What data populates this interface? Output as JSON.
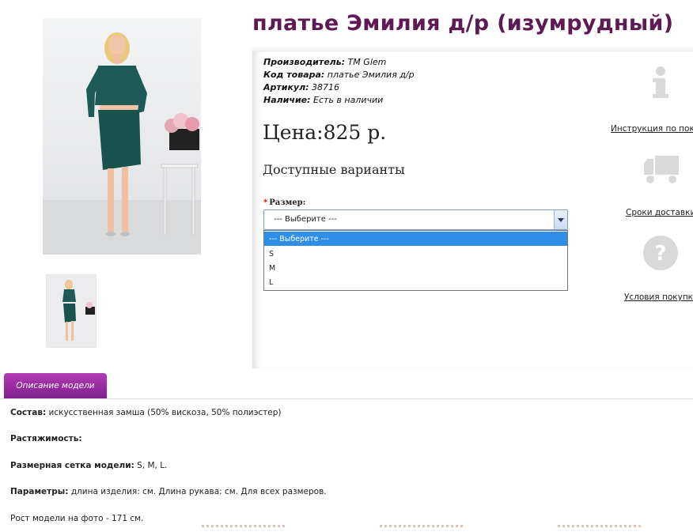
{
  "product": {
    "title": "платье Эмилия д/р (изумрудный)",
    "price": "Цена:825 р.",
    "available_options": "Доступные варианты"
  },
  "meta": {
    "manufacturer_label": "Производитель:",
    "manufacturer_value": " ТМ Glem",
    "code_label": "Код товара:",
    "code_value": " платье Эмилия д/р",
    "sku_label": "Артикул:",
    "sku_value": " 38716",
    "stock_label": "Наличие:",
    "stock_value": " Есть в наличии"
  },
  "size_select": {
    "required_mark": "*",
    "label": "Размер:",
    "value": "--- Выберите ---",
    "options": [
      "--- Выберите ---",
      "S",
      "M",
      "L"
    ]
  },
  "side_links": {
    "instruction": "Инструкция по поку",
    "delivery": "Сроки доставки",
    "terms": "Условия покупки"
  },
  "tabs": {
    "description": "Описание модели"
  },
  "description": {
    "composition_label": "Состав:",
    "composition_value": " искусственная замша (50% вискоза, 50% полиэстер)",
    "stretch_label": "Растяжимость:",
    "size_grid_label": "Размерная сетка модели:",
    "size_grid_value": " S, M, L.",
    "params_label": "Параметры:",
    "params_value": " длина изделия: см. Длина рукава: см. Для всех размеров.",
    "model_height": "Рост модели на фото - 171 см."
  },
  "colors": {
    "title": "#5d1a55",
    "tab": "#9b2ca3",
    "dress": "#1e5a56",
    "select_highlight": "#2f8fe8"
  }
}
